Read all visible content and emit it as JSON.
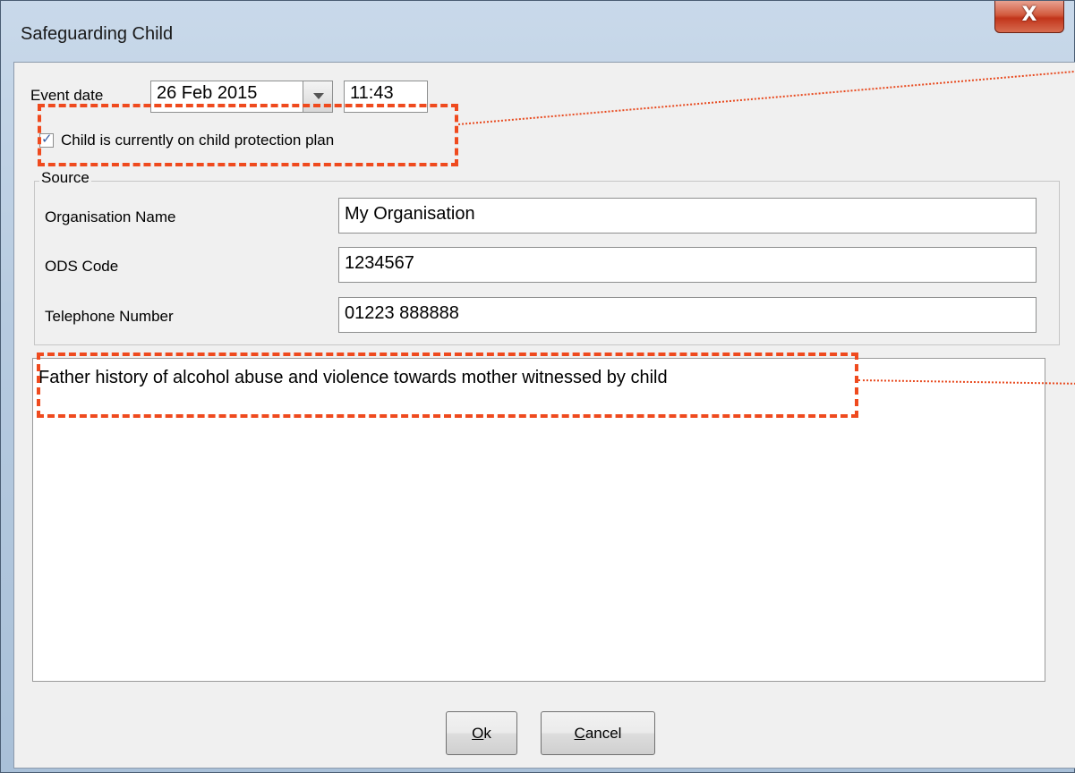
{
  "window": {
    "title": "Safeguarding Child",
    "close_glyph": "X"
  },
  "event": {
    "label": "Event date",
    "date": "26 Feb 2015",
    "time": "11:43"
  },
  "protection": {
    "checked": true,
    "label": "Child is currently on child protection plan"
  },
  "source": {
    "legend": "Source",
    "fields": [
      {
        "label": "Organisation Name",
        "value": "My Organisation"
      },
      {
        "label": "ODS Code",
        "value": "1234567"
      },
      {
        "label": "Telephone Number",
        "value": "01223 888888"
      }
    ]
  },
  "notes": {
    "text": "Father history of alcohol abuse and violence towards mother witnessed by child"
  },
  "buttons": {
    "ok_mnemonic": "O",
    "ok_rest": "k",
    "cancel_mnemonic": "C",
    "cancel_rest": "ancel"
  },
  "colors": {
    "annotation": "#ef4a1e",
    "close": "#c2341a"
  }
}
